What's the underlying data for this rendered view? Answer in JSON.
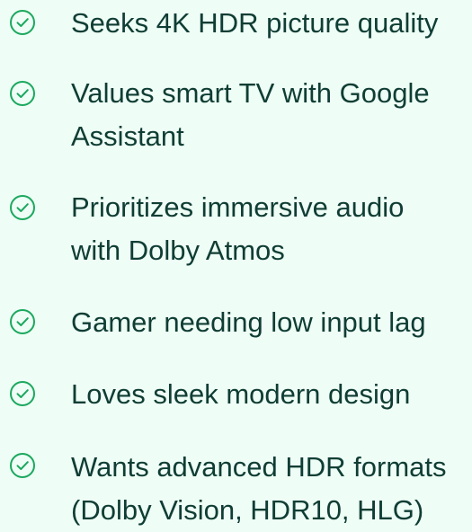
{
  "criteria": {
    "icon": "check-circle-icon",
    "icon_color": "#1ba85f",
    "text_color": "#0f3d34",
    "background": "#eefdf5",
    "items": [
      {
        "lines": [
          "Seeks 4K HDR picture quality"
        ]
      },
      {
        "lines": [
          "Values smart TV with Google",
          "Assistant"
        ]
      },
      {
        "lines": [
          "Prioritizes immersive audio",
          "with Dolby Atmos"
        ]
      },
      {
        "lines": [
          "Gamer needing low input lag"
        ]
      },
      {
        "lines": [
          "Loves sleek modern design"
        ]
      },
      {
        "lines": [
          "Wants advanced HDR formats",
          "(Dolby Vision, HDR10, HLG)"
        ]
      }
    ]
  }
}
